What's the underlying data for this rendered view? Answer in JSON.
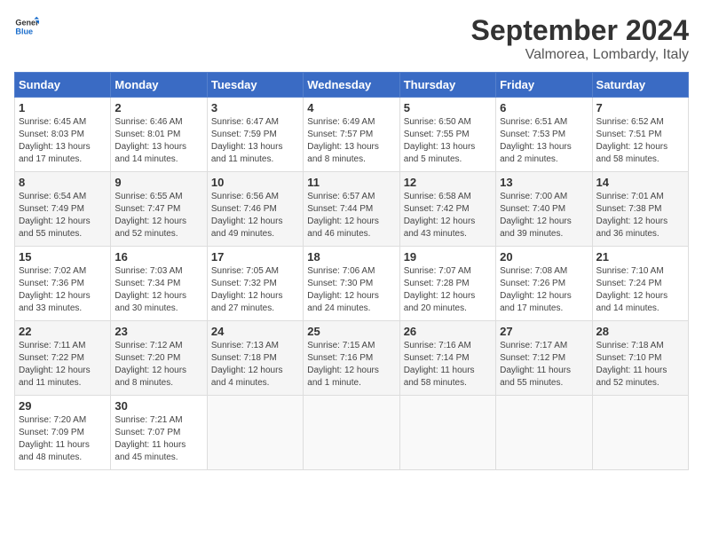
{
  "header": {
    "logo_line1": "General",
    "logo_line2": "Blue",
    "month": "September 2024",
    "location": "Valmorea, Lombardy, Italy"
  },
  "weekdays": [
    "Sunday",
    "Monday",
    "Tuesday",
    "Wednesday",
    "Thursday",
    "Friday",
    "Saturday"
  ],
  "weeks": [
    [
      {
        "day": "1",
        "detail": "Sunrise: 6:45 AM\nSunset: 8:03 PM\nDaylight: 13 hours\nand 17 minutes."
      },
      {
        "day": "2",
        "detail": "Sunrise: 6:46 AM\nSunset: 8:01 PM\nDaylight: 13 hours\nand 14 minutes."
      },
      {
        "day": "3",
        "detail": "Sunrise: 6:47 AM\nSunset: 7:59 PM\nDaylight: 13 hours\nand 11 minutes."
      },
      {
        "day": "4",
        "detail": "Sunrise: 6:49 AM\nSunset: 7:57 PM\nDaylight: 13 hours\nand 8 minutes."
      },
      {
        "day": "5",
        "detail": "Sunrise: 6:50 AM\nSunset: 7:55 PM\nDaylight: 13 hours\nand 5 minutes."
      },
      {
        "day": "6",
        "detail": "Sunrise: 6:51 AM\nSunset: 7:53 PM\nDaylight: 13 hours\nand 2 minutes."
      },
      {
        "day": "7",
        "detail": "Sunrise: 6:52 AM\nSunset: 7:51 PM\nDaylight: 12 hours\nand 58 minutes."
      }
    ],
    [
      {
        "day": "8",
        "detail": "Sunrise: 6:54 AM\nSunset: 7:49 PM\nDaylight: 12 hours\nand 55 minutes."
      },
      {
        "day": "9",
        "detail": "Sunrise: 6:55 AM\nSunset: 7:47 PM\nDaylight: 12 hours\nand 52 minutes."
      },
      {
        "day": "10",
        "detail": "Sunrise: 6:56 AM\nSunset: 7:46 PM\nDaylight: 12 hours\nand 49 minutes."
      },
      {
        "day": "11",
        "detail": "Sunrise: 6:57 AM\nSunset: 7:44 PM\nDaylight: 12 hours\nand 46 minutes."
      },
      {
        "day": "12",
        "detail": "Sunrise: 6:58 AM\nSunset: 7:42 PM\nDaylight: 12 hours\nand 43 minutes."
      },
      {
        "day": "13",
        "detail": "Sunrise: 7:00 AM\nSunset: 7:40 PM\nDaylight: 12 hours\nand 39 minutes."
      },
      {
        "day": "14",
        "detail": "Sunrise: 7:01 AM\nSunset: 7:38 PM\nDaylight: 12 hours\nand 36 minutes."
      }
    ],
    [
      {
        "day": "15",
        "detail": "Sunrise: 7:02 AM\nSunset: 7:36 PM\nDaylight: 12 hours\nand 33 minutes."
      },
      {
        "day": "16",
        "detail": "Sunrise: 7:03 AM\nSunset: 7:34 PM\nDaylight: 12 hours\nand 30 minutes."
      },
      {
        "day": "17",
        "detail": "Sunrise: 7:05 AM\nSunset: 7:32 PM\nDaylight: 12 hours\nand 27 minutes."
      },
      {
        "day": "18",
        "detail": "Sunrise: 7:06 AM\nSunset: 7:30 PM\nDaylight: 12 hours\nand 24 minutes."
      },
      {
        "day": "19",
        "detail": "Sunrise: 7:07 AM\nSunset: 7:28 PM\nDaylight: 12 hours\nand 20 minutes."
      },
      {
        "day": "20",
        "detail": "Sunrise: 7:08 AM\nSunset: 7:26 PM\nDaylight: 12 hours\nand 17 minutes."
      },
      {
        "day": "21",
        "detail": "Sunrise: 7:10 AM\nSunset: 7:24 PM\nDaylight: 12 hours\nand 14 minutes."
      }
    ],
    [
      {
        "day": "22",
        "detail": "Sunrise: 7:11 AM\nSunset: 7:22 PM\nDaylight: 12 hours\nand 11 minutes."
      },
      {
        "day": "23",
        "detail": "Sunrise: 7:12 AM\nSunset: 7:20 PM\nDaylight: 12 hours\nand 8 minutes."
      },
      {
        "day": "24",
        "detail": "Sunrise: 7:13 AM\nSunset: 7:18 PM\nDaylight: 12 hours\nand 4 minutes."
      },
      {
        "day": "25",
        "detail": "Sunrise: 7:15 AM\nSunset: 7:16 PM\nDaylight: 12 hours\nand 1 minute."
      },
      {
        "day": "26",
        "detail": "Sunrise: 7:16 AM\nSunset: 7:14 PM\nDaylight: 11 hours\nand 58 minutes."
      },
      {
        "day": "27",
        "detail": "Sunrise: 7:17 AM\nSunset: 7:12 PM\nDaylight: 11 hours\nand 55 minutes."
      },
      {
        "day": "28",
        "detail": "Sunrise: 7:18 AM\nSunset: 7:10 PM\nDaylight: 11 hours\nand 52 minutes."
      }
    ],
    [
      {
        "day": "29",
        "detail": "Sunrise: 7:20 AM\nSunset: 7:09 PM\nDaylight: 11 hours\nand 48 minutes."
      },
      {
        "day": "30",
        "detail": "Sunrise: 7:21 AM\nSunset: 7:07 PM\nDaylight: 11 hours\nand 45 minutes."
      },
      {
        "day": "",
        "detail": ""
      },
      {
        "day": "",
        "detail": ""
      },
      {
        "day": "",
        "detail": ""
      },
      {
        "day": "",
        "detail": ""
      },
      {
        "day": "",
        "detail": ""
      }
    ]
  ]
}
